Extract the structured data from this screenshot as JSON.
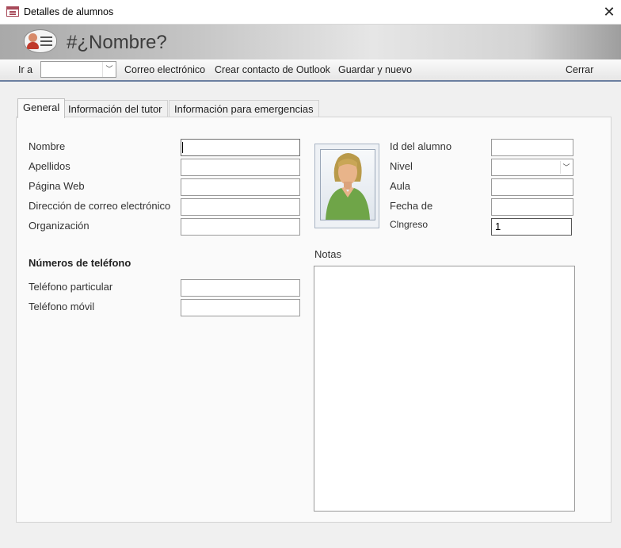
{
  "window": {
    "title": "Detalles de alumnos"
  },
  "header": {
    "title": "#¿Nombre?"
  },
  "toolbar": {
    "goto_label": "Ir a",
    "goto_value": "",
    "email_label": "Correo electrónico",
    "outlook_label": "Crear contacto de Outlook",
    "save_new_label": "Guardar y nuevo",
    "close_label": "Cerrar"
  },
  "tabs": [
    "General",
    "Información del tutor",
    "Información para emergencias"
  ],
  "active_tab": "General",
  "left_fields": {
    "nombre": {
      "label": "Nombre",
      "value": ""
    },
    "apellidos": {
      "label": "Apellidos",
      "value": ""
    },
    "pagina_web": {
      "label": "Página Web",
      "value": ""
    },
    "correo": {
      "label": "Dirección de correo electrónico",
      "value": ""
    },
    "organizacion": {
      "label": "Organización",
      "value": ""
    }
  },
  "phones": {
    "section_title": "Números de teléfono",
    "particular": {
      "label": "Teléfono particular",
      "value": ""
    },
    "movil": {
      "label": "Teléfono móvil",
      "value": ""
    }
  },
  "right_fields": {
    "id_alumno": {
      "label": "Id del alumno",
      "value": ""
    },
    "nivel": {
      "label": "Nivel",
      "value": ""
    },
    "aula": {
      "label": "Aula",
      "value": ""
    },
    "fecha_de": {
      "label": "Fecha de",
      "value": ""
    },
    "clngreso": {
      "label": "Clngreso",
      "value": "1"
    }
  },
  "notes": {
    "label": "Notas",
    "value": ""
  },
  "colors": {
    "toolbar_border": "#6b7fa0",
    "photo_border": "#a8b4c4"
  }
}
